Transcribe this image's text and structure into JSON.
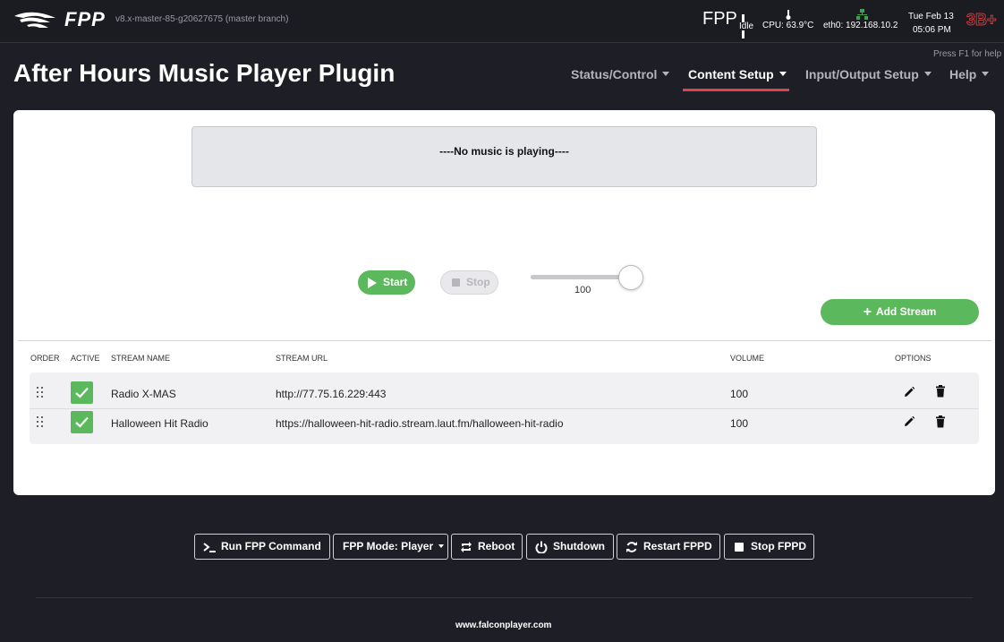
{
  "header": {
    "logo_text": "FPP",
    "version": "v8.x-master-85-g20627675 (master branch)",
    "fpp_label": "FPP",
    "status": "Idle",
    "cpu": "CPU: 63.9°C",
    "eth": "eth0: 192.168.10.2",
    "date": "Tue Feb 13",
    "time": "05:06 PM",
    "device_badge": "3B+",
    "help_hint": "Press F1 for help"
  },
  "page": {
    "title": "After Hours Music Player Plugin"
  },
  "nav": [
    {
      "label": "Status/Control"
    },
    {
      "label": "Content Setup"
    },
    {
      "label": "Input/Output Setup"
    },
    {
      "label": "Help"
    }
  ],
  "player": {
    "now_playing": "----No music is playing----",
    "start_label": "Start",
    "stop_label": "Stop",
    "volume": "100",
    "add_stream_label": "Add Stream"
  },
  "table": {
    "headers": {
      "order": "ORDER",
      "active": "ACTIVE",
      "name": "STREAM NAME",
      "url": "STREAM URL",
      "volume": "VOLUME",
      "options": "OPTIONS"
    },
    "rows": [
      {
        "name": "Radio X-MAS",
        "url": "http://77.75.16.229:443",
        "volume": "100",
        "active": true
      },
      {
        "name": "Halloween Hit Radio",
        "url": "https://halloween-hit-radio.stream.laut.fm/halloween-hit-radio",
        "volume": "100",
        "active": true
      }
    ]
  },
  "footer_buttons": {
    "run_command": "Run FPP Command",
    "mode": "FPP Mode: Player",
    "reboot": "Reboot",
    "shutdown": "Shutdown",
    "restart": "Restart FPPD",
    "stop": "Stop FPPD"
  },
  "footer": {
    "link": "www.falconplayer.com"
  },
  "colors": {
    "accent_green": "#5cb85c",
    "nav_underline": "#e0404a",
    "page_bg": "#1e1e26"
  }
}
